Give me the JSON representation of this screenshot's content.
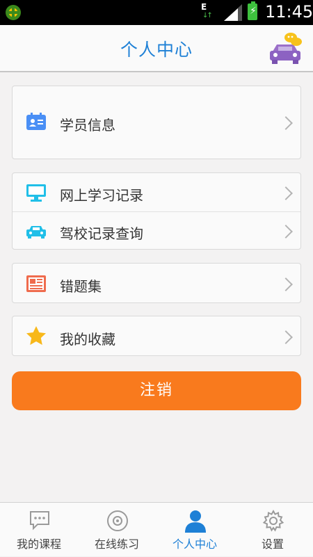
{
  "status_bar": {
    "network": "E",
    "time": "11:45"
  },
  "header": {
    "title": "个人中心"
  },
  "menu": {
    "student_info": "学员信息",
    "online_study": "网上学习记录",
    "school_record": "驾校记录查询",
    "wrong_questions": "错题集",
    "favorites": "我的收藏"
  },
  "logout_label": "注销",
  "tabs": [
    {
      "label": "我的课程",
      "icon": "chat-bubble-icon"
    },
    {
      "label": "在线练习",
      "icon": "disc-icon"
    },
    {
      "label": "个人中心",
      "icon": "person-icon",
      "active": true
    },
    {
      "label": "设置",
      "icon": "gear-icon"
    }
  ],
  "colors": {
    "accent": "#1e80d6",
    "logout": "#f97a1d",
    "background": "#f3f2f2"
  }
}
